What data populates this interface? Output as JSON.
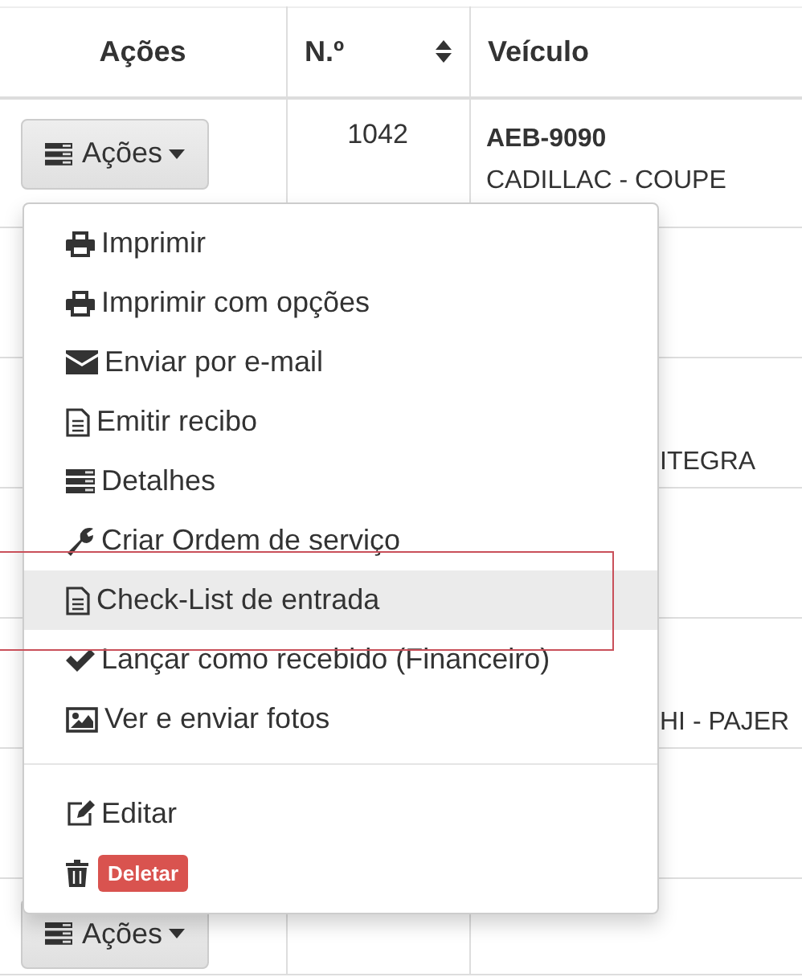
{
  "table": {
    "columns": [
      {
        "label": "Ações"
      },
      {
        "label": "N.º",
        "sortable": true
      },
      {
        "label": "Veículo"
      }
    ],
    "rows": [
      {
        "button": "Ações",
        "number": "1042",
        "plate": "AEB-9090",
        "model": "CADILLAC - COUPE"
      },
      {},
      {
        "model": "ITEGRA"
      },
      {},
      {
        "model": "HI - PAJER"
      },
      {},
      {
        "button": "Ações"
      }
    ]
  },
  "menu": {
    "groups": [
      [
        {
          "label": "Imprimir",
          "selected": false
        },
        {
          "label": "Imprimir com opções",
          "selected": false
        },
        {
          "label": "Enviar por e-mail",
          "selected": false
        },
        {
          "label": "Emitir recibo",
          "selected": false
        },
        {
          "label": "Detalhes",
          "selected": false
        },
        {
          "label": "Criar Ordem de serviço",
          "selected": false
        },
        {
          "label": "Check-List de entrada",
          "selected": true
        },
        {
          "label": "Lançar como recebido (Financeiro)",
          "selected": false
        },
        {
          "label": "Ver e enviar fotos",
          "selected": false
        }
      ],
      [
        {
          "label": "Editar",
          "selected": false,
          "kind": "plain"
        },
        {
          "label": "Deletar",
          "selected": false,
          "kind": "badge"
        }
      ]
    ]
  }
}
